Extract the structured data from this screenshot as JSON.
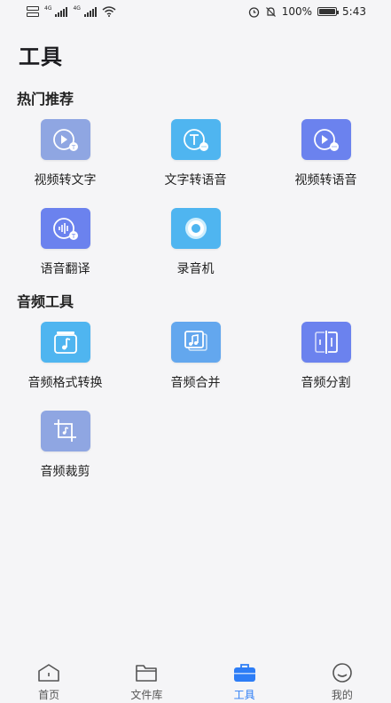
{
  "status_bar": {
    "network_1": "4G",
    "network_2": "4G",
    "battery": "100%",
    "time": "5:43"
  },
  "page_title": "工具",
  "sections": [
    {
      "title": "热门推荐",
      "items": [
        {
          "label": "视频转文字",
          "icon": "video-to-text-icon",
          "color": "#7f9ee0"
        },
        {
          "label": "文字转语音",
          "icon": "text-to-speech-icon",
          "color": "#4fb5f0"
        },
        {
          "label": "视频转语音",
          "icon": "video-to-speech-icon",
          "color": "#6b82ee"
        },
        {
          "label": "语音翻译",
          "icon": "voice-translate-icon",
          "color": "#6b82ee"
        },
        {
          "label": "录音机",
          "icon": "recorder-icon",
          "color": "#4fb5f0"
        }
      ]
    },
    {
      "title": "音频工具",
      "items": [
        {
          "label": "音频格式转换",
          "icon": "audio-format-convert-icon",
          "color": "#4fb5f0"
        },
        {
          "label": "音频合并",
          "icon": "audio-merge-icon",
          "color": "#63a7ee"
        },
        {
          "label": "音频分割",
          "icon": "audio-split-icon",
          "color": "#6b82ee"
        },
        {
          "label": "音频裁剪",
          "icon": "audio-crop-icon",
          "color": "#7f9ee0"
        }
      ]
    }
  ],
  "tabbar": {
    "items": [
      {
        "label": "首页",
        "icon": "home-icon"
      },
      {
        "label": "文件库",
        "icon": "folder-icon"
      },
      {
        "label": "工具",
        "icon": "toolbox-icon",
        "active": true
      },
      {
        "label": "我的",
        "icon": "smile-icon"
      }
    ],
    "active_color": "#2d7df6"
  }
}
